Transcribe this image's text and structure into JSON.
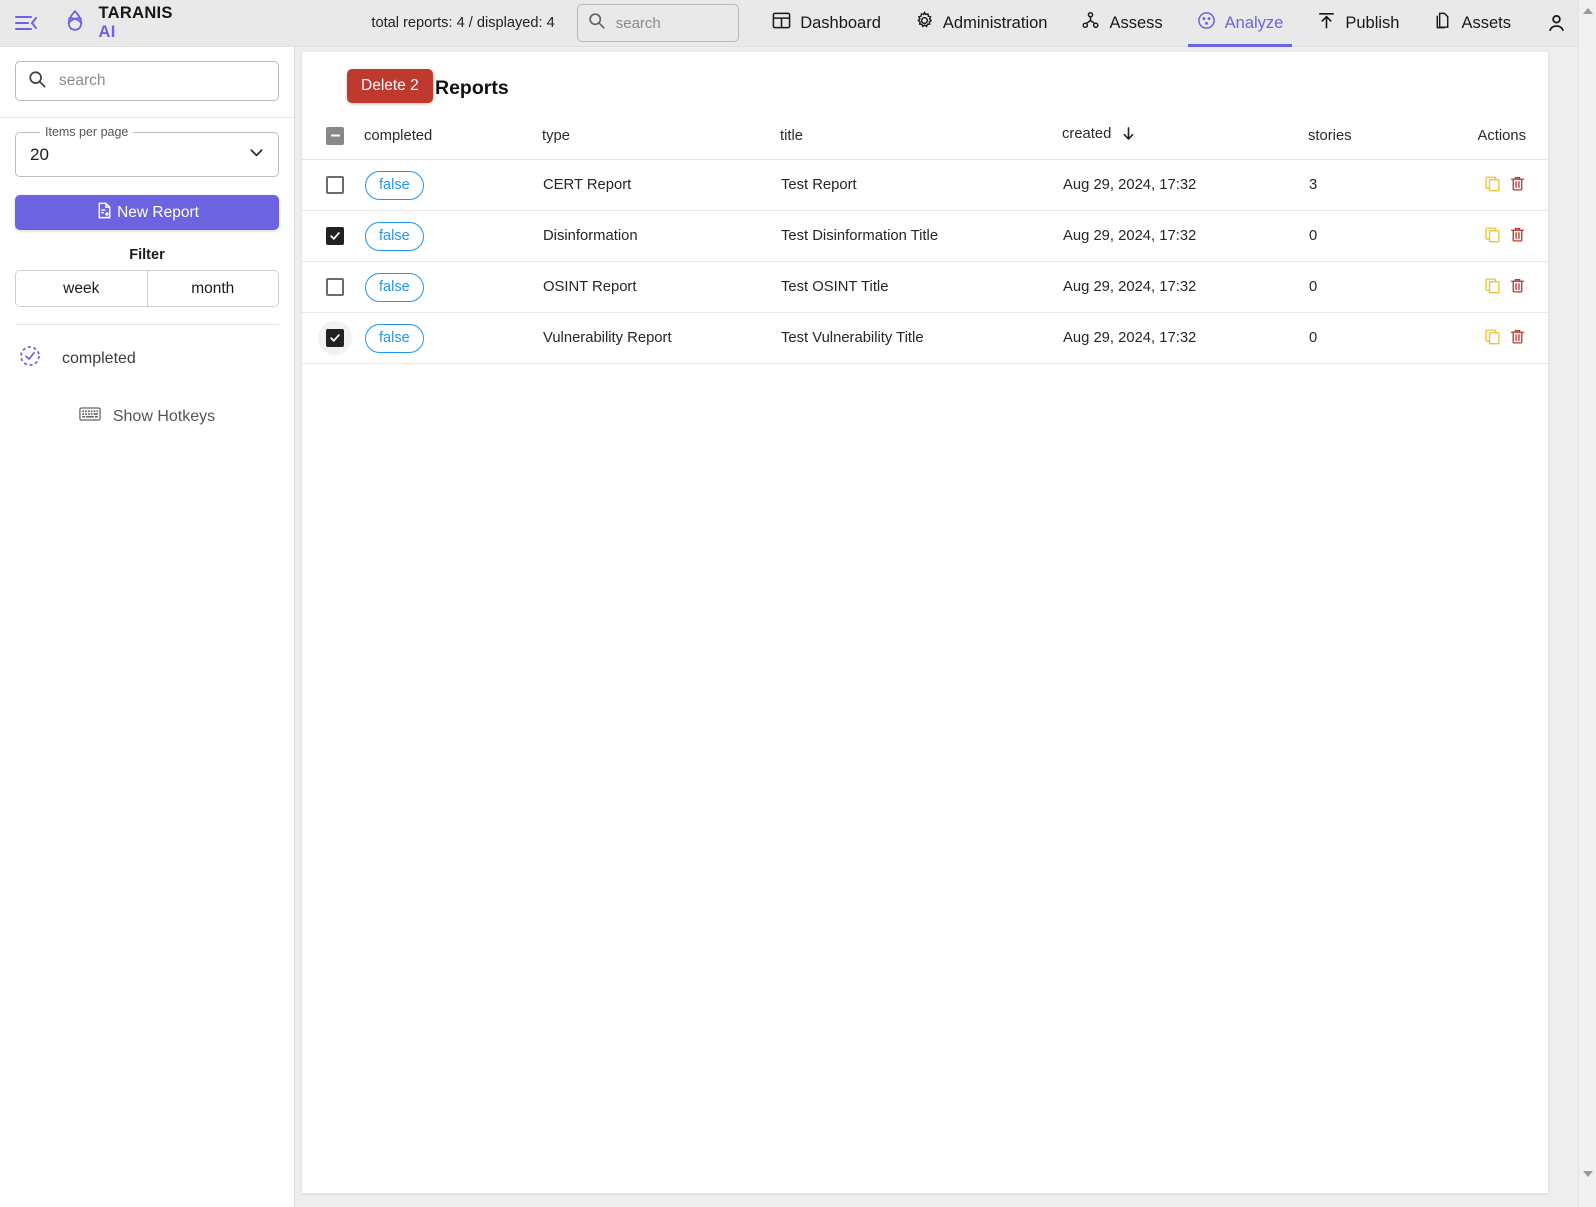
{
  "topbar": {
    "menu_icon": "hamburger-collapse-icon",
    "brand_name": "TARANIS",
    "brand_suffix": "AI",
    "brand_logo_icon": "taranis-triquetra-logo-icon",
    "report_counts": "total reports: 4 / displayed: 4",
    "search_placeholder": "search",
    "search_value": "",
    "search_icon": "search-icon",
    "account_icon": "account-person-icon",
    "nav": [
      {
        "label": "Dashboard",
        "icon": "dashboard-grid-icon",
        "active": false
      },
      {
        "label": "Administration",
        "icon": "gear-icon",
        "active": false
      },
      {
        "label": "Assess",
        "icon": "assess-nodes-icon",
        "active": false
      },
      {
        "label": "Analyze",
        "icon": "analyze-circle-dots-icon",
        "active": true
      },
      {
        "label": "Publish",
        "icon": "publish-upload-arrow-icon",
        "active": false
      },
      {
        "label": "Assets",
        "icon": "assets-documents-icon",
        "active": false
      }
    ],
    "accent_color": "#6c63e0"
  },
  "sidebar": {
    "search_placeholder": "search",
    "search_value": "",
    "search_icon": "search-icon",
    "items_per_page_legend": "Items per page",
    "items_per_page_value": "20",
    "items_per_page_options": [
      "20"
    ],
    "chevron_icon": "chevron-down-icon",
    "new_report_label": "New Report",
    "new_report_icon": "new-document-plus-icon",
    "filter_title": "Filter",
    "filter_segments": [
      {
        "label": "week",
        "selected": false
      },
      {
        "label": "month",
        "selected": false
      }
    ],
    "completed_label": "completed",
    "completed_icon": "completed-dashed-check-icon",
    "hotkeys_label": "Show Hotkeys",
    "hotkeys_icon": "keyboard-icon"
  },
  "main": {
    "delete_label": "Delete 2",
    "delete_color": "#c0392e",
    "page_title": "Reports",
    "table": {
      "header_checkbox_state": "indeterminate",
      "columns": [
        {
          "key": "completed",
          "label": "completed"
        },
        {
          "key": "type",
          "label": "type"
        },
        {
          "key": "title",
          "label": "title"
        },
        {
          "key": "created",
          "label": "created",
          "sorted": "desc",
          "sort_icon": "arrow-down-icon"
        },
        {
          "key": "stories",
          "label": "stories"
        },
        {
          "key": "actions",
          "label": "Actions"
        }
      ],
      "rows": [
        {
          "selected": false,
          "hovered": false,
          "completed": "false",
          "type": "CERT Report",
          "title": "Test Report",
          "created": "Aug 29, 2024, 17:32",
          "stories": "3",
          "actions": [
            "copy-icon",
            "delete-trash-icon"
          ]
        },
        {
          "selected": true,
          "hovered": false,
          "completed": "false",
          "type": "Disinformation",
          "title": "Test Disinformation Title",
          "created": "Aug 29, 2024, 17:32",
          "stories": "0",
          "actions": [
            "copy-icon",
            "delete-trash-icon"
          ]
        },
        {
          "selected": false,
          "hovered": false,
          "completed": "false",
          "type": "OSINT Report",
          "title": "Test OSINT Title",
          "created": "Aug 29, 2024, 17:32",
          "stories": "0",
          "actions": [
            "copy-icon",
            "delete-trash-icon"
          ]
        },
        {
          "selected": true,
          "hovered": true,
          "completed": "false",
          "type": "Vulnerability Report",
          "title": "Test Vulnerability Title",
          "created": "Aug 29, 2024, 17:32",
          "stories": "0",
          "actions": [
            "copy-icon",
            "delete-trash-icon"
          ]
        }
      ]
    }
  },
  "scrollbar": {
    "up_icon": "scroll-up-arrow-icon",
    "down_icon": "scroll-down-arrow-icon"
  }
}
